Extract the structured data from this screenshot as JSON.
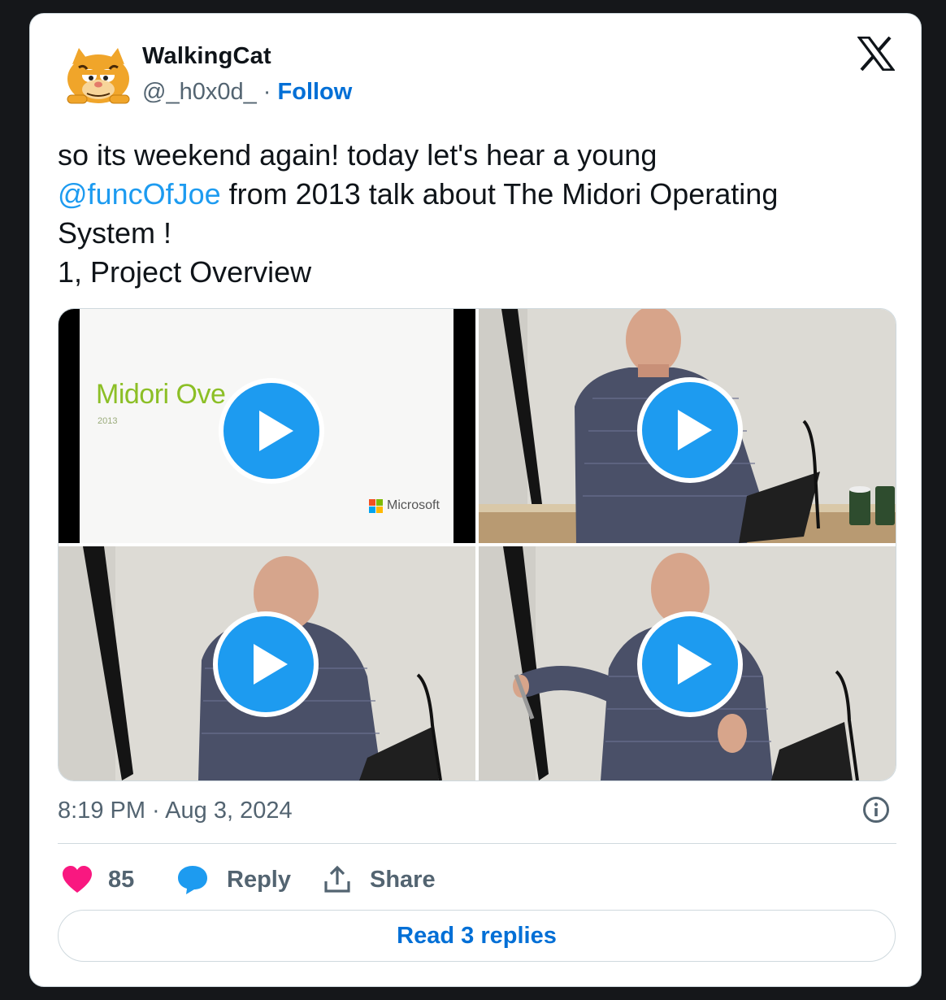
{
  "tweet": {
    "author": {
      "name": "WalkingCat",
      "handle": "@_h0x0d_",
      "separator": "·",
      "follow_label": "Follow"
    },
    "text": {
      "intro": "so its weekend again! today let's hear a young",
      "mention": "@funcOfJoe",
      "rest_line1": " from 2013 talk about The Midori Operating",
      "line2": "System !",
      "line3": "1, Project Overview"
    },
    "media": {
      "slide": {
        "title": "Midori Ove",
        "year": "2013",
        "brand": "Microsoft"
      },
      "videos": [
        {
          "kind": "slide",
          "icon": "play-icon"
        },
        {
          "kind": "speaker",
          "icon": "play-icon"
        },
        {
          "kind": "speaker",
          "icon": "play-icon"
        },
        {
          "kind": "speaker",
          "icon": "play-icon"
        }
      ]
    },
    "timestamp": "8:19 PM · Aug 3, 2024",
    "actions": {
      "like_count": "85",
      "reply_label": "Reply",
      "share_label": "Share"
    },
    "read_replies_label": "Read 3 replies"
  },
  "colors": {
    "background": "#15171a",
    "card": "#ffffff",
    "link": "#1d9bf0",
    "follow": "#006fd6",
    "heart": "#f91880",
    "muted": "#536471"
  }
}
